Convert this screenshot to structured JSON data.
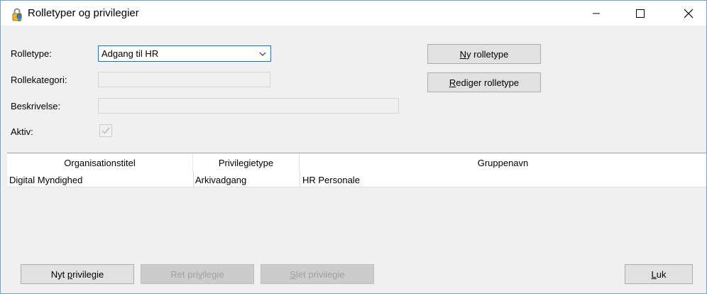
{
  "window": {
    "title": "Rolletyper og privilegier"
  },
  "form": {
    "rolletype_label": "Rolletype:",
    "rolletype_value": "Adgang til HR",
    "rollekategori_label": "Rollekategori:",
    "rollekategori_value": "",
    "beskrivelse_label": "Beskrivelse:",
    "beskrivelse_value": "",
    "aktiv_label": "Aktiv:",
    "aktiv_checked": true
  },
  "buttons": {
    "ny_rolletype_u": "N",
    "ny_rolletype_rest": "y rolletype",
    "rediger_rolletype_u": "R",
    "rediger_rolletype_rest": "ediger rolletype",
    "nyt_privilegie_pre": "Nyt ",
    "nyt_privilegie_u": "p",
    "nyt_privilegie_rest": "rivilegie",
    "ret_privilegie_pre": "Ret pri",
    "ret_privilegie_u": "v",
    "ret_privilegie_rest": "ilegie",
    "slet_privilegie_u": "S",
    "slet_privilegie_rest": "let privilegie",
    "luk_u": "L",
    "luk_rest": "uk"
  },
  "table": {
    "columns": [
      "Organisationstitel",
      "Privilegietype",
      "Gruppenavn"
    ],
    "rows": [
      [
        "Digital Myndighed",
        "Arkivadgang",
        "HR Personale"
      ]
    ]
  },
  "colors": {
    "accent": "#0078d7",
    "background": "#f0f0f0",
    "disabled_text": "#a0a0a0"
  }
}
